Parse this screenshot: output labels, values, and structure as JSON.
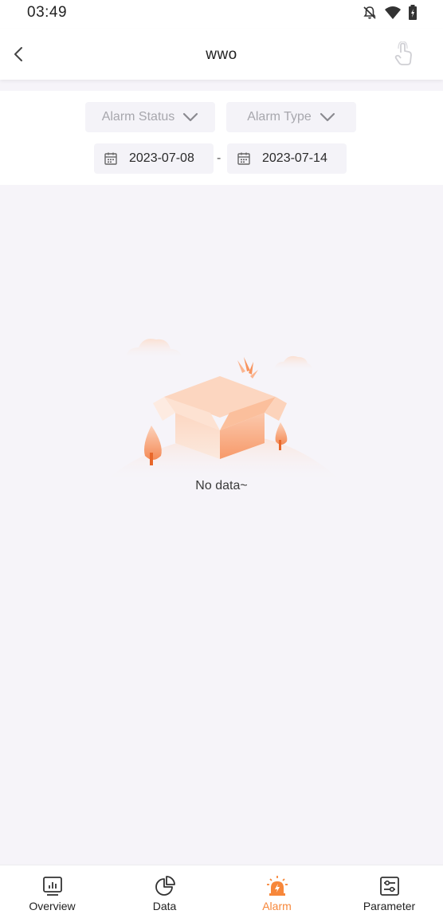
{
  "status_bar": {
    "time": "03:49",
    "icons": [
      "bell-off-icon",
      "wifi-icon",
      "battery-icon"
    ]
  },
  "header": {
    "title": "wwo",
    "back_icon": "chevron-left-icon",
    "action_icon": "touch-icon"
  },
  "filters": {
    "alarm_status_label": "Alarm Status",
    "alarm_type_label": "Alarm Type",
    "start_date": "2023-07-08",
    "end_date": "2023-07-14",
    "date_separator": "-"
  },
  "empty_state": {
    "message": "No data~"
  },
  "bottom_nav": {
    "items": [
      {
        "label": "Overview",
        "icon": "chart-monitor-icon",
        "active": false
      },
      {
        "label": "Data",
        "icon": "pie-chart-icon",
        "active": false
      },
      {
        "label": "Alarm",
        "icon": "alarm-siren-icon",
        "active": true
      },
      {
        "label": "Parameter",
        "icon": "sliders-icon",
        "active": false
      }
    ]
  },
  "colors": {
    "accent": "#f7873a",
    "background": "#f6f4f9",
    "field_bg": "#f4f3f8",
    "placeholder_text": "#a7a7ad"
  }
}
